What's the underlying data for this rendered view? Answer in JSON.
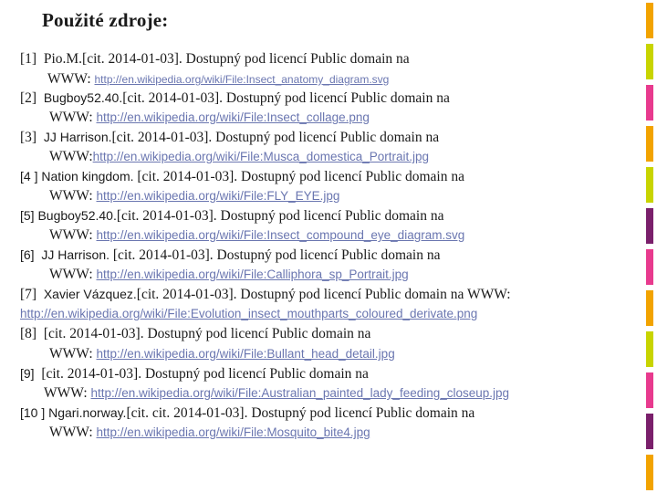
{
  "title": "Použité zdroje:",
  "refs": [
    {
      "num": "[1]",
      "author": "Pio.M.",
      "text": "[cit. 2014-01-03]. Dostupný pod licencí Public domain na",
      "www": "WWW:",
      "url": "http://en.wikipedia.org/wiki/File:Insect_anatomy_diagram.svg"
    },
    {
      "num": "[2]",
      "author": "Bugboy52.40.",
      "text": "[cit. 2014-01-03]. Dostupný pod licencí Public domain na",
      "www": "WWW:",
      "url": "http://en.wikipedia.org/wiki/File:Insect_collage.png"
    },
    {
      "num": "[3]",
      "author": "JJ Harrison.",
      "text": "[cit. 2014-01-03]. Dostupný pod licencí Public domain na",
      "www": "WWW:",
      "url": "http://en.wikipedia.org/wiki/File:Musca_domestica_Portrait.jpg"
    },
    {
      "num": "[4 ]",
      "author": "Nation kingdom.",
      "text": "[cit. 2014-01-03]. Dostupný pod licencí Public domain na",
      "www": "WWW:",
      "url": "http://en.wikipedia.org/wiki/File:FLY_EYE.jpg"
    },
    {
      "num": "[5]",
      "author": "Bugboy52.40.",
      "text": "[cit. 2014-01-03]. Dostupný pod licencí Public domain na",
      "www": "WWW:",
      "url": "http://en.wikipedia.org/wiki/File:Insect_compound_eye_diagram.svg"
    },
    {
      "num": "[6]",
      "author": "JJ Harrison.",
      "text": "[cit. 2014-01-03]. Dostupný pod licencí Public domain na",
      "www": "WWW:",
      "url": "http://en.wikipedia.org/wiki/File:Calliphora_sp_Portrait.jpg"
    },
    {
      "num": "[7]",
      "author": "Xavier Vázquez.",
      "text": "[cit. 2014-01-03]. Dostupný pod licencí Public domain na WWW:",
      "url": "http://en.wikipedia.org/wiki/File:Evolution_insect_mouthparts_coloured_derivate.png"
    },
    {
      "num": "[8]",
      "author": "",
      "text": "[cit. 2014-01-03]. Dostupný pod licencí Public domain na",
      "www": "WWW:",
      "url": "http://en.wikipedia.org/wiki/File:Bullant_head_detail.jpg"
    },
    {
      "num": "[9]",
      "author": "",
      "text": "[cit. 2014-01-03]. Dostupný pod licencí Public domain na",
      "www": "WWW:",
      "url": "http://en.wikipedia.org/wiki/File:Australian_painted_lady_feeding_closeup.jpg"
    },
    {
      "num": "[10 ]",
      "author": "Ngari.norway.",
      "text": "[cit. cit. 2014-01-03]. Dostupný pod licencí Public domain na",
      "www": "WWW:",
      "url": "http://en.wikipedia.org/wiki/File:Mosquito_bite4.jpg"
    }
  ],
  "colors": {
    "link": "#6a76b0",
    "stripe": [
      "#f2a300",
      "#c8d400",
      "#e83a8e",
      "#f2a300",
      "#c8d400",
      "#7a1f6b",
      "#e83a8e",
      "#f2a300",
      "#c8d400",
      "#e83a8e",
      "#7a1f6b",
      "#f2a300"
    ]
  }
}
